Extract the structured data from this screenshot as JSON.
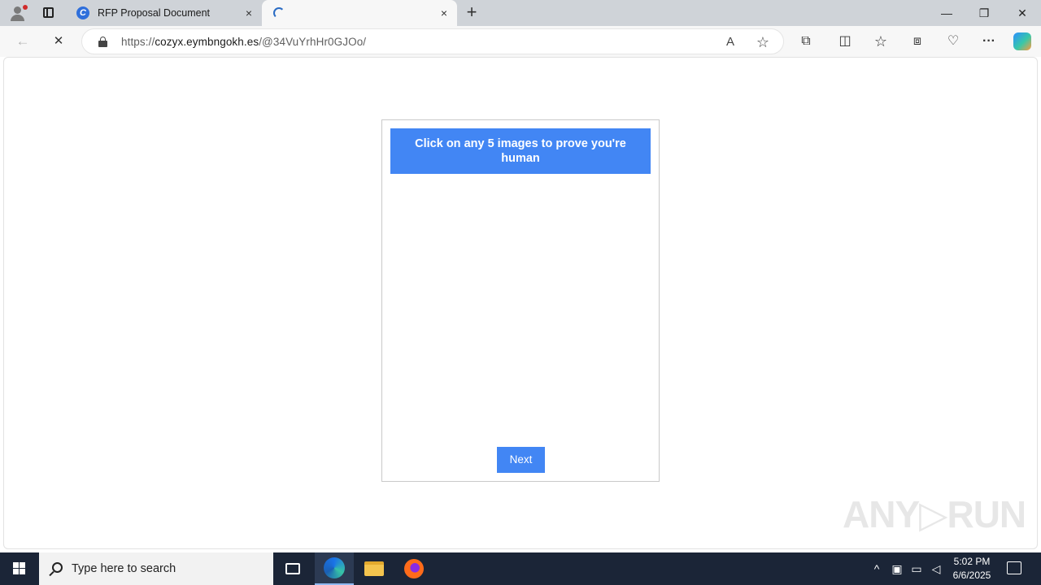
{
  "browser": {
    "tabs": [
      {
        "title": "RFP Proposal Document",
        "state": "inactive"
      },
      {
        "title": "",
        "state": "loading"
      }
    ],
    "url_prefix": "https://",
    "url_domain": "cozyx.eymbngokh.es",
    "url_path": "/@34VuYrhHr0GJOo/",
    "icons": {
      "close": "×",
      "new_tab": "+",
      "back": "←",
      "stop": "✕",
      "read_aloud": "A",
      "favorite": "☆",
      "extensions": "⧉",
      "split": "◫",
      "favorites": "☆",
      "collections": "⧈",
      "health": "♡",
      "more": "···",
      "minimize": "—",
      "restore": "❐",
      "window_close": "✕"
    }
  },
  "captcha": {
    "heading": "Click on any 5 images to prove you're human",
    "next_label": "Next"
  },
  "watermark": "ANY▷RUN",
  "taskbar": {
    "search_placeholder": "Type here to search",
    "time": "5:02 PM",
    "date": "6/6/2025",
    "tray_chevron": "^"
  }
}
